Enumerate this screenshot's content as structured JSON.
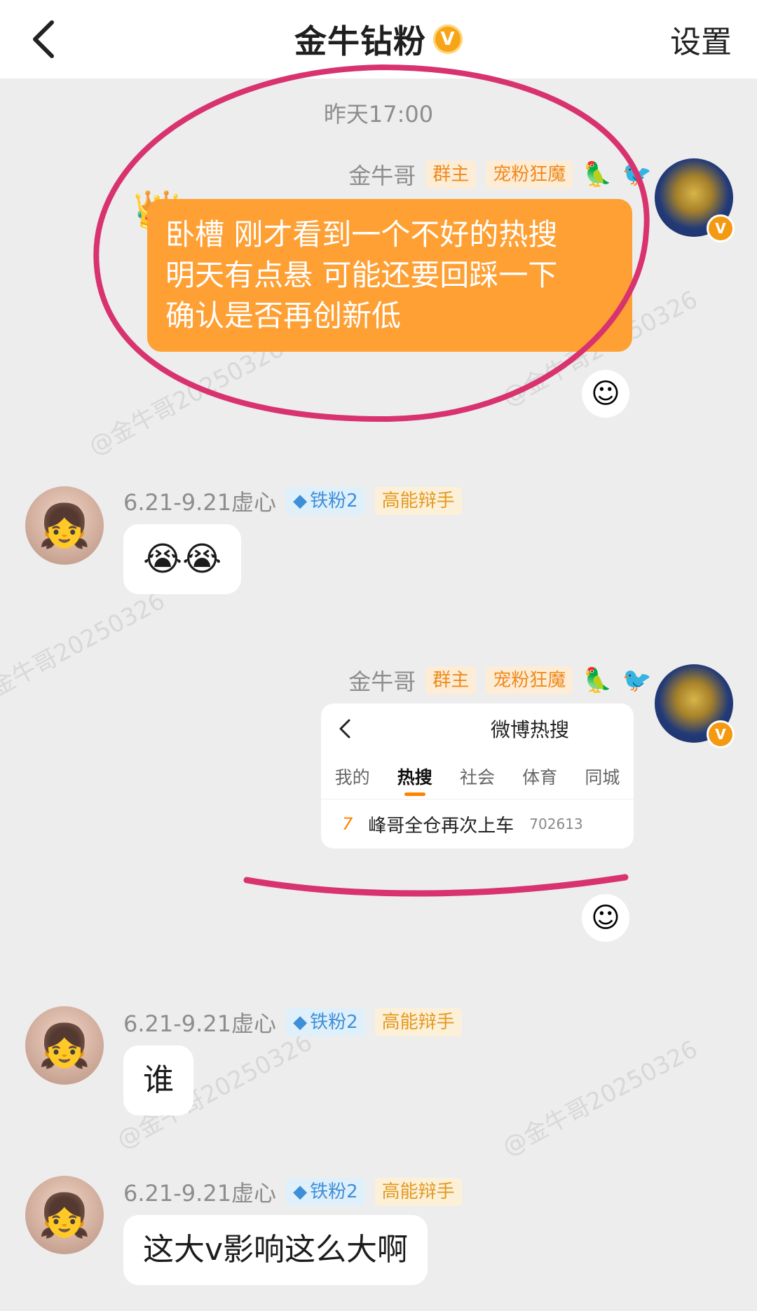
{
  "header": {
    "back_label": "返回",
    "title": "金牛钻粉",
    "title_badge": "V",
    "settings_label": "设置"
  },
  "timestamp": "昨天17:00",
  "watermark": "@金牛哥20250326",
  "messages": [
    {
      "sender": "金牛哥",
      "tags": [
        "群主",
        "宠粉狂魔"
      ],
      "side": "right",
      "text_lines": [
        "卧槽 刚才看到一个不好的热搜",
        "明天有点悬 可能还要回踩一下",
        "确认是否再创新低"
      ]
    },
    {
      "sender": "6.21-9.21虚心",
      "tags": [
        "铁粉2",
        "高能辩手"
      ],
      "side": "left",
      "text": "😭😭"
    },
    {
      "sender": "金牛哥",
      "tags": [
        "群主",
        "宠粉狂魔"
      ],
      "side": "right",
      "card": {
        "title": "微博热搜",
        "tabs": [
          "我的",
          "热搜",
          "社会",
          "体育",
          "同城"
        ],
        "active_tab": "热搜",
        "row": {
          "rank": "7",
          "text": "峰哥全仓再次上车",
          "heat": "702613"
        }
      }
    },
    {
      "sender": "6.21-9.21虚心",
      "tags": [
        "铁粉2",
        "高能辩手"
      ],
      "side": "left",
      "text": "谁"
    },
    {
      "sender": "6.21-9.21虚心",
      "tags": [
        "铁粉2",
        "高能辩手"
      ],
      "side": "left",
      "text": "这大v影响这么大啊"
    }
  ],
  "colors": {
    "accent_orange": "#ffa034",
    "annotation_pink": "#d8336f",
    "background": "#ededed"
  }
}
